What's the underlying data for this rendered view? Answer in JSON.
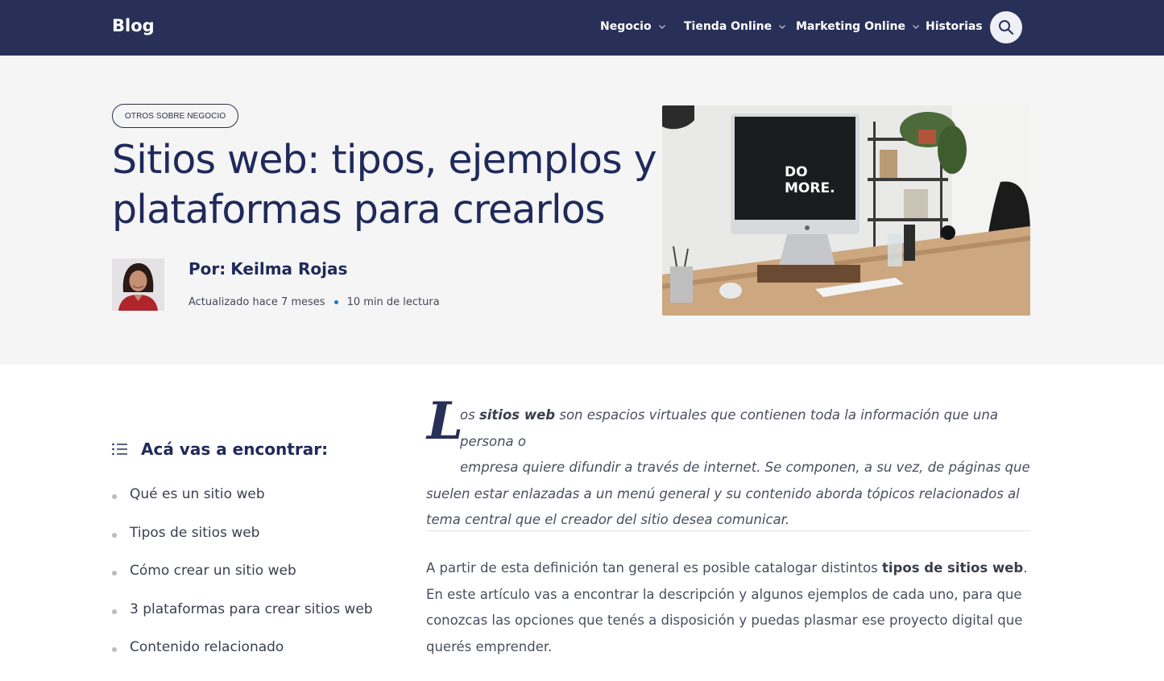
{
  "header": {
    "brand": "Blog",
    "nav": [
      {
        "label": "Negocio",
        "has_dropdown": true
      },
      {
        "label": "Tienda Online",
        "has_dropdown": true
      },
      {
        "label": "Marketing Online",
        "has_dropdown": true
      },
      {
        "label": "Historias",
        "has_dropdown": false
      }
    ],
    "search_icon": "search-icon"
  },
  "hero": {
    "category": "OTROS SOBRE NEGOCIO",
    "title": "Sitios web: tipos, ejemplos y plataformas para crearlos",
    "author_prefix": "Por:",
    "author_name": "Keilma Rojas",
    "updated": "Actualizado hace 7 meses",
    "read_time": "10 min de lectura",
    "image_text_line1": "DO",
    "image_text_line2": "MORE."
  },
  "toc": {
    "title": "Acá vas a encontrar:",
    "icon": "list-icon",
    "items": [
      "Qué es un sitio web",
      "Tipos de sitios web",
      "Cómo crear un sitio web",
      "3 plataformas para crear sitios web",
      "Contenido relacionado"
    ]
  },
  "article": {
    "dropcap": "L",
    "intro_line1_pre": "os ",
    "intro_line1_bold": "sitios web",
    "intro_line1_post": " son espacios virtuales que contienen toda la información que una persona o",
    "intro_line2": "empresa quiere difundir a través de internet. Se componen, a su vez, de páginas que",
    "intro_rest": "suelen estar enlazadas a un menú general y su contenido aborda tópicos relacionados al tema central que el creador del sitio desea comunicar.",
    "para_pre": "A partir de esta definición tan general es posible catalogar distintos ",
    "para_bold": "tipos de sitios web",
    "para_post": ". En este artículo vas a encontrar la descripción y algunos ejemplos de cada uno, para que conozcas las opciones que tenés a disposición y puedas plasmar ese proyecto digital que querés emprender."
  },
  "colors": {
    "nav_bg": "#283057",
    "hero_bg": "#f5f5f6",
    "title": "#1f2a5a",
    "meta_dot": "#1976d2"
  }
}
